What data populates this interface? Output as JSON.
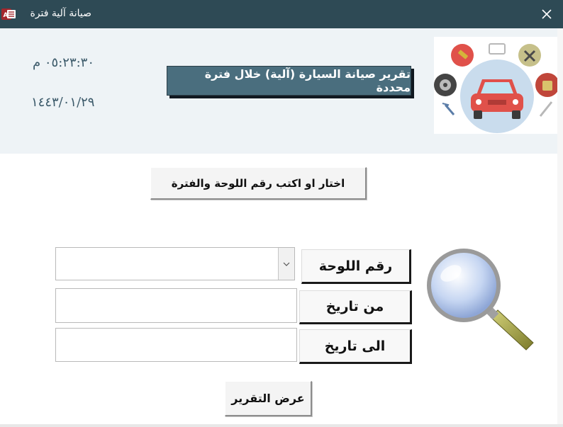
{
  "window": {
    "title": "صيانة آلية فترة",
    "app_icon": "access-icon",
    "close_icon": "close-icon"
  },
  "header": {
    "time": "٠٥:٢٣:٣٠ م",
    "date": "١٤٤٣/٠١/٢٩",
    "report_title": "تقرير صيانة السيارة (آلية) خلال فترة محددة",
    "illustration": "car-maintenance-icon"
  },
  "form": {
    "select_button": "اختار او اكتب رقم اللوحة والفترة",
    "plate_label": "رقم اللوحة",
    "plate_value": "",
    "from_label": "من تاريخ",
    "from_value": "",
    "to_label": "الى تاريخ",
    "to_value": "",
    "show_report_button": "عرض التقرير",
    "magnifier_icon": "magnifier-icon"
  },
  "colors": {
    "titlebar": "#2e4a55",
    "header_bg": "#eef3f6",
    "title_box": "#4a6e7e",
    "car_red": "#e0514a"
  }
}
